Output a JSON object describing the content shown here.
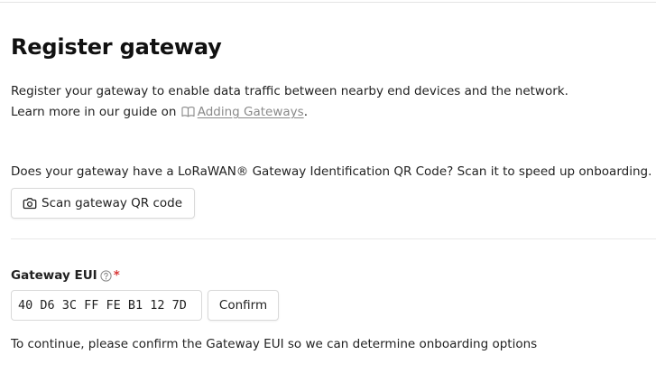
{
  "page": {
    "title": "Register gateway"
  },
  "intro": {
    "line1": "Register your gateway to enable data traffic between nearby end devices and the network.",
    "line2_prefix": "Learn more in our guide on",
    "guide_link_label": "Adding Gateways",
    "line2_suffix": "."
  },
  "qr": {
    "question": "Does your gateway have a LoRaWAN® Gateway Identification QR Code? Scan it to speed up onboarding.",
    "scan_button_label": "Scan gateway QR code"
  },
  "gateway_eui": {
    "label": "Gateway EUI",
    "required_marker": "*",
    "value": "40 D6 3C FF FE B1 12 7D",
    "confirm_label": "Confirm",
    "note": "To continue, please confirm the Gateway EUI so we can determine onboarding options"
  },
  "icons": {
    "guide": "book-icon",
    "scan": "camera-icon",
    "help": "help-circle-icon"
  },
  "colors": {
    "required": "#d93838",
    "link": "#8a8a8a",
    "border": "#d9d9d9"
  }
}
